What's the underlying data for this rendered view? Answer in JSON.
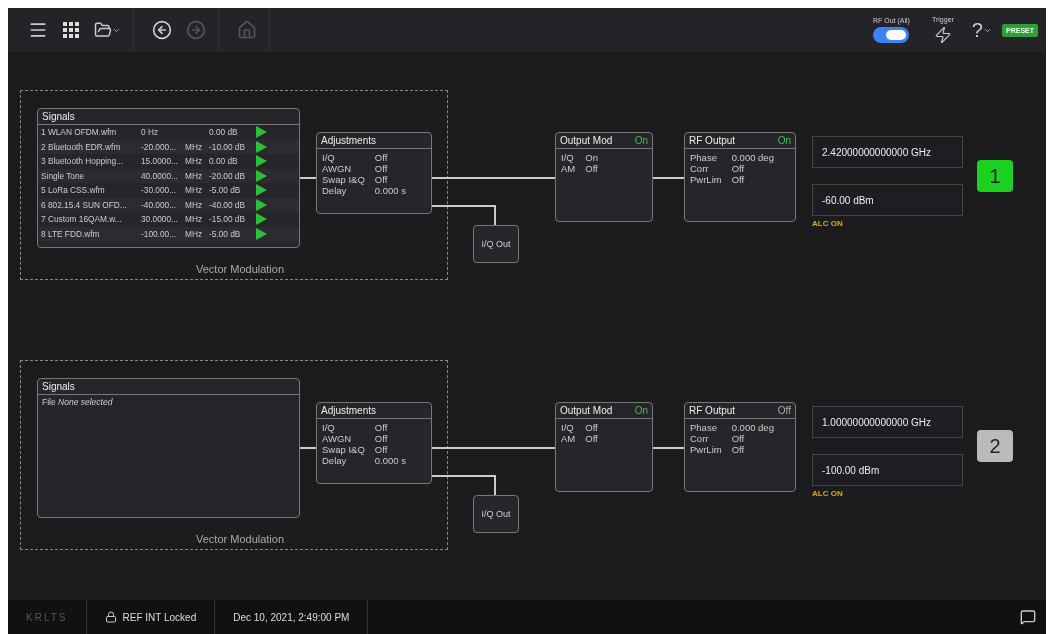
{
  "toolbar": {
    "back_disabled": false,
    "forward_disabled": true,
    "home_disabled": true,
    "rf_out": {
      "label": "RF Out (All)",
      "on": true
    },
    "trigger": {
      "label": "Trigger"
    },
    "help": "?",
    "preset": "PRESET"
  },
  "channels": [
    {
      "number": "1",
      "active": true,
      "group_label": "Vector Modulation",
      "signals": {
        "title": "Signals",
        "rows": [
          {
            "name": "1 WLAN OFDM.wfm",
            "freq": "0 Hz",
            "unit": "",
            "power": "0.00 dB",
            "playing": true
          },
          {
            "name": "2 Bluetooth EDR.wfm",
            "freq": "-20.000...",
            "unit": "MHz",
            "power": "-10.00 dB",
            "playing": true
          },
          {
            "name": "3 Bluetooth Hopping...",
            "freq": "15.0000...",
            "unit": "MHz",
            "power": "0.00 dB",
            "playing": true
          },
          {
            "name": "Single Tone",
            "freq": "40.0000...",
            "unit": "MHz",
            "power": "-20.00 dB",
            "playing": true
          },
          {
            "name": "5 LoRa CSS.wfm",
            "freq": "-30.000...",
            "unit": "MHz",
            "power": "-5.00 dB",
            "playing": true
          },
          {
            "name": "6 802.15.4 SUN OFD...",
            "freq": "-40.000...",
            "unit": "MHz",
            "power": "-40.00 dB",
            "playing": true
          },
          {
            "name": "7 Custom 16QAM.w...",
            "freq": "30.0000...",
            "unit": "MHz",
            "power": "-15.00 dB",
            "playing": true
          },
          {
            "name": "8 LTE FDD.wfm",
            "freq": "-100.00...",
            "unit": "MHz",
            "power": "-5.00 dB",
            "playing": true
          }
        ]
      },
      "adjustments": {
        "title": "Adjustments",
        "rows": [
          {
            "label": "I/Q",
            "value": "Off"
          },
          {
            "label": "AWGN",
            "value": "Off"
          },
          {
            "label": "Swap I&Q",
            "value": "Off"
          },
          {
            "label": "Delay",
            "value": "0.000 s"
          }
        ]
      },
      "iq_out": "I/Q Out",
      "output_mod": {
        "title": "Output Mod",
        "status": "On",
        "on": true,
        "rows": [
          {
            "label": "I/Q",
            "value": "On"
          },
          {
            "label": "AM",
            "value": "Off"
          }
        ]
      },
      "rf_output": {
        "title": "RF Output",
        "status": "On",
        "on": true,
        "rows": [
          {
            "label": "Phase",
            "value": "0.000 deg"
          },
          {
            "label": "Corr",
            "value": "Off"
          },
          {
            "label": "PwrLim",
            "value": "Off"
          }
        ]
      },
      "frequency": "2.42000000000000 GHz",
      "power": "-60.00 dBm",
      "alc": "ALC ON"
    },
    {
      "number": "2",
      "active": false,
      "group_label": "Vector Modulation",
      "signals": {
        "title": "Signals",
        "file_text": "File *None selected*"
      },
      "adjustments": {
        "title": "Adjustments",
        "rows": [
          {
            "label": "I/Q",
            "value": "Off"
          },
          {
            "label": "AWGN",
            "value": "Off"
          },
          {
            "label": "Swap I&Q",
            "value": "Off"
          },
          {
            "label": "Delay",
            "value": "0.000 s"
          }
        ]
      },
      "iq_out": "I/Q Out",
      "output_mod": {
        "title": "Output Mod",
        "status": "On",
        "on": true,
        "rows": [
          {
            "label": "I/Q",
            "value": "Off"
          },
          {
            "label": "AM",
            "value": "Off"
          }
        ]
      },
      "rf_output": {
        "title": "RF Output",
        "status": "Off",
        "on": false,
        "rows": [
          {
            "label": "Phase",
            "value": "0.000 deg"
          },
          {
            "label": "Corr",
            "value": "Off"
          },
          {
            "label": "PwrLim",
            "value": "Off"
          }
        ]
      },
      "frequency": "1.00000000000000 GHz",
      "power": "-100.00 dBm",
      "alc": "ALC ON"
    }
  ],
  "status_bar": {
    "brand": "KRLTS",
    "ref": "REF INT Locked",
    "datetime": "Dec 10, 2021, 2:49:00 PM"
  }
}
